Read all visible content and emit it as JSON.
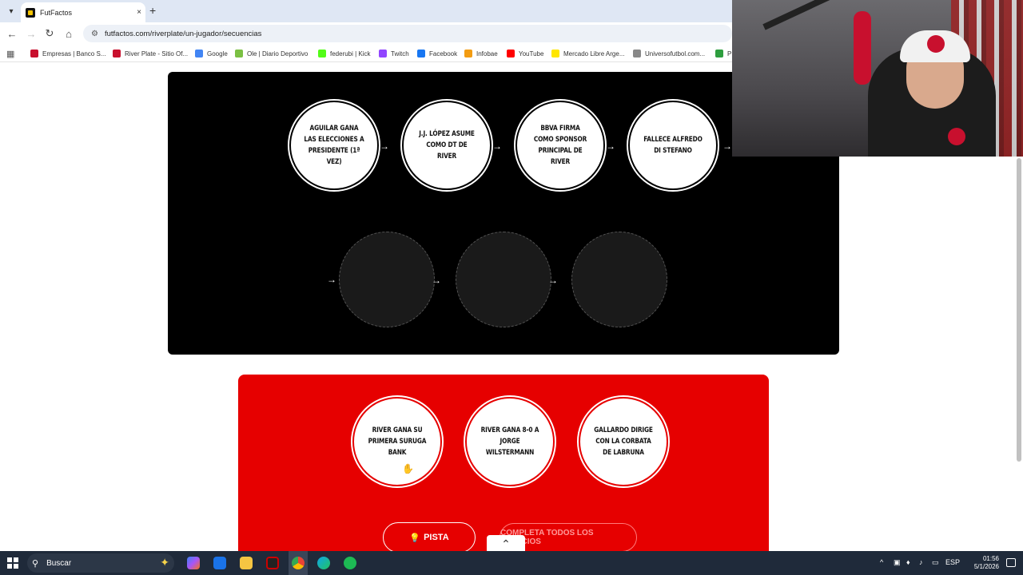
{
  "browser": {
    "tab_title": "FutFactos",
    "tab_close": "×",
    "new_tab": "+",
    "url": "futfactos.com/riverplate/un-jugador/secuencias",
    "bookmarks": [
      {
        "label": "Empresas | Banco S...",
        "icon_color": "#c8102e"
      },
      {
        "label": "River Plate - Sitio Of...",
        "icon_color": "#c8102e"
      },
      {
        "label": "Google",
        "icon_color": "#4285f4"
      },
      {
        "label": "Ole | Diario Deportivo",
        "icon_color": "#7bc043"
      },
      {
        "label": "federubi | Kick",
        "icon_color": "#53fc18"
      },
      {
        "label": "Twitch",
        "icon_color": "#9146ff"
      },
      {
        "label": "Facebook",
        "icon_color": "#1877f2"
      },
      {
        "label": "Infobae",
        "icon_color": "#f39c12"
      },
      {
        "label": "YouTube",
        "icon_color": "#ff0000"
      },
      {
        "label": "Mercado Libre Arge...",
        "icon_color": "#ffe600"
      },
      {
        "label": "Universofutbol.com...",
        "icon_color": "#888888"
      },
      {
        "label": "PR",
        "icon_color": "#2e9e3f"
      }
    ]
  },
  "sequence": {
    "placed": [
      "AGUILAR GANA LAS ELECCIONES A PRESIDENTE (1ª VEZ)",
      "J.J. LÓPEZ ASUME COMO DT DE RIVER",
      "BBVA FIRMA COMO SPONSOR PRINCIPAL DE RIVER",
      "FALLECE ALFREDO DI STEFANO"
    ],
    "arrow": "→"
  },
  "options": [
    "RIVER GANA SU PRIMERA SURUGA BANK",
    "RIVER GANA 8-0 A JORGE WILSTERMANN",
    "GALLARDO DIRIGE CON LA CORBATA DE LABRUNA"
  ],
  "buttons": {
    "hint": "PISTA",
    "complete": "COMPLETA TODOS LOS ESPACIOS"
  },
  "taskbar": {
    "search_placeholder": "Buscar",
    "language": "ESP",
    "time": "01:56",
    "date": "5/1/2026"
  },
  "colors": {
    "sequence_bg": "#000000",
    "options_bg": "#e60000"
  }
}
